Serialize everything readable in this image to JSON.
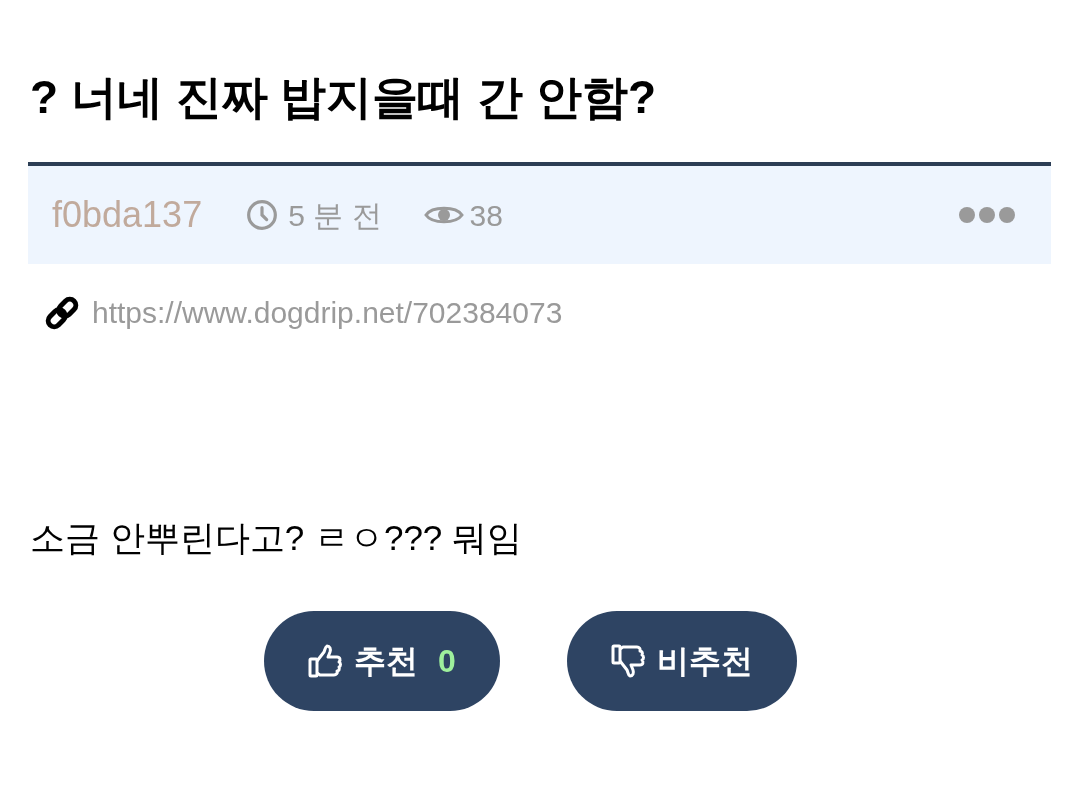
{
  "post": {
    "title": "? 너네 진짜 밥지을때 간 안함?",
    "author": "f0bda137",
    "time": "5 분 전",
    "views": "38",
    "link": "https://www.dogdrip.net/702384073",
    "body": "소금 안뿌린다고? ㄹㅇ??? 뭐임"
  },
  "votes": [
    {
      "kind": "up",
      "label": "추천",
      "count": "0"
    },
    {
      "kind": "down",
      "label": "비추천"
    }
  ]
}
